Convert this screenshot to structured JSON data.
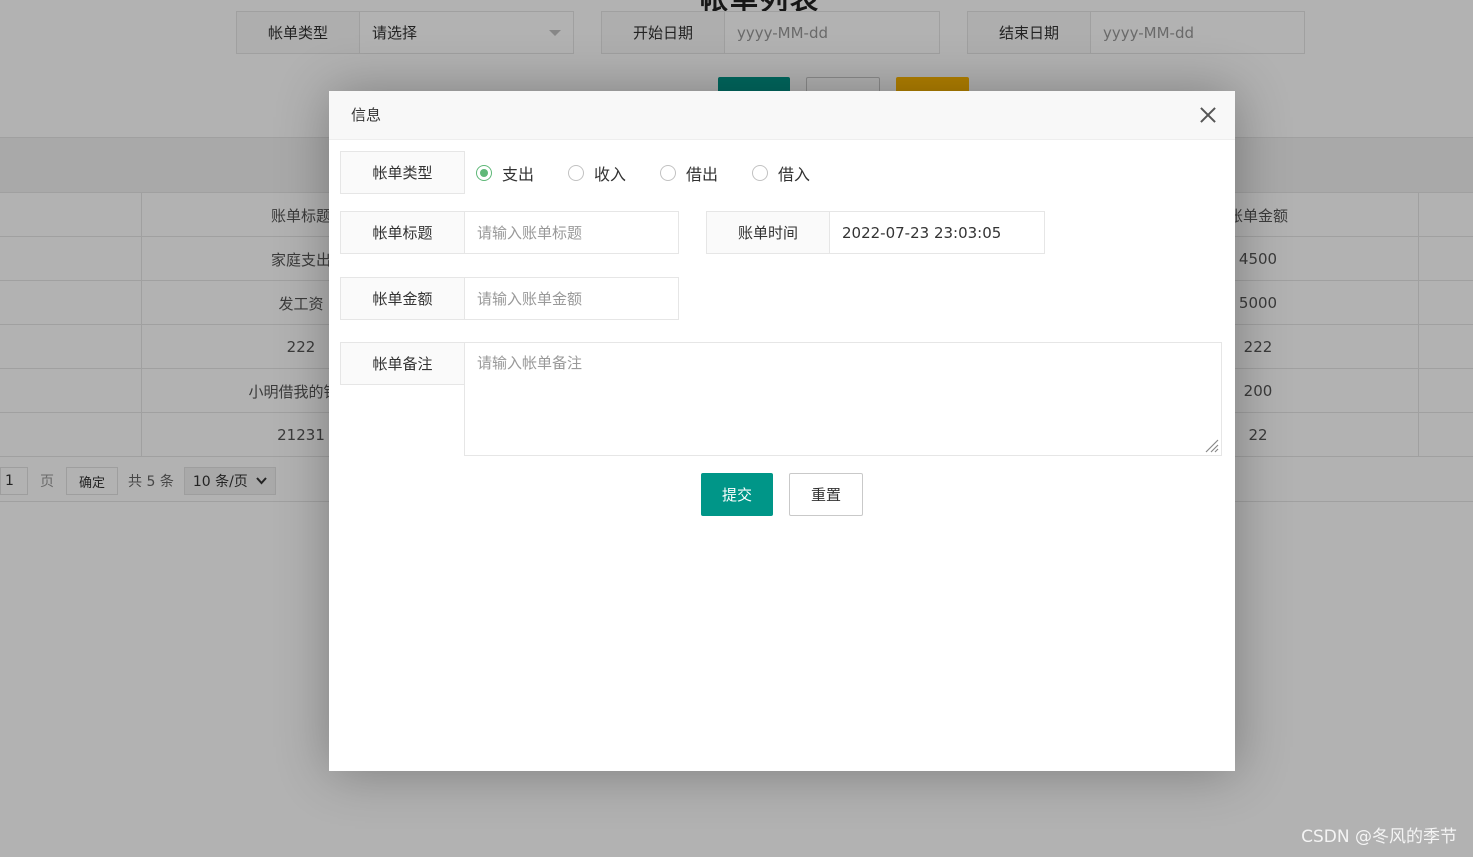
{
  "background": {
    "page_title": "帐单列表",
    "filters": [
      {
        "label": "帐单类型",
        "value": "请选择"
      },
      {
        "label": "开始日期",
        "placeholder": "yyyy-MM-dd"
      },
      {
        "label": "结束日期",
        "placeholder": "yyyy-MM-dd"
      }
    ],
    "toolbar_colors": {
      "search": "#009688",
      "reset": "#ffffff",
      "export": "#FFB800"
    },
    "table": {
      "columns": [
        "账单标题",
        "账单金额"
      ],
      "rows": [
        {
          "title": "家庭支出",
          "amount": "4500"
        },
        {
          "title": "发工资",
          "amount": "5000"
        },
        {
          "title": "222",
          "amount": "222"
        },
        {
          "title": "小明借我的钱去",
          "amount": "200"
        },
        {
          "title": "21231",
          "amount": "22"
        }
      ]
    },
    "pager": {
      "current": "1",
      "page_unit": "页",
      "confirm": "确定",
      "total": "共 5 条",
      "page_size": "10 条/页"
    }
  },
  "modal": {
    "title": "信息",
    "fields": {
      "type_label": "帐单类型",
      "type_options": [
        "支出",
        "收入",
        "借出",
        "借入"
      ],
      "type_selected": "支出",
      "title_label": "帐单标题",
      "title_placeholder": "请输入账单标题",
      "time_label": "账单时间",
      "time_value": "2022-07-23 23:03:05",
      "amount_label": "帐单金额",
      "amount_placeholder": "请输入账单金额",
      "remark_label": "帐单备注",
      "remark_placeholder": "请输入帐单备注"
    },
    "buttons": {
      "submit": "提交",
      "reset": "重置"
    },
    "accent_color": "#009688",
    "radio_color": "#5FB878"
  },
  "watermark": "CSDN @冬风的季节"
}
